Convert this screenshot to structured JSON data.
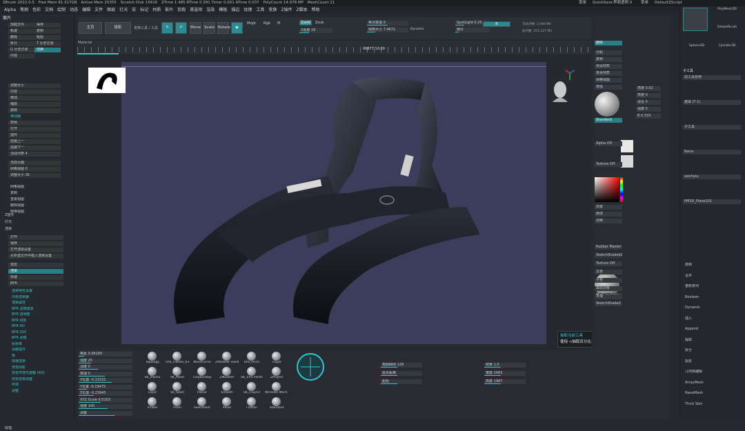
{
  "titlebar": {
    "app": "ZBrush 2022.0.5",
    "items": [
      "Free Mem 81.317GB",
      "Active Mem 25355",
      "Scratch Disk 15616",
      "ZTime 1.485 RTime 0.391 Timer 0.001 ATime 0.037",
      "PolyCount 14.978 MP",
      "MeshCount 21"
    ],
    "right": [
      "菜单",
      "QuickSave",
      "界面透明 0",
      "菜单",
      "DefaultZScript"
    ]
  },
  "menu": [
    "Alpha",
    "笔刷",
    "色彩",
    "文档",
    "绘制",
    "动态",
    "编辑",
    "文件",
    "图层",
    "灯光",
    "宏",
    "标记",
    "材质",
    "影片",
    "拾取",
    "首选项",
    "渲染",
    "模板",
    "描边",
    "纹理",
    "工具",
    "变换",
    "Z插件",
    "Z脚本",
    "帮助"
  ],
  "toolbar": {
    "home": "主页",
    "projection": "投影",
    "tool": "变换工具 / 工具",
    "edit": "Edit",
    "draw": "Draw",
    "move": "Move",
    "scale": "Scale",
    "rotate": "Rotate",
    "mrgb": "Mrgb",
    "rgb": "Rgb",
    "m": "M",
    "zadd": "Zadd",
    "zsub": "Zsub",
    "zcut": "Zcut",
    "focal": "焦点衰减 0",
    "draw_size": "绘制大小 7.4671",
    "dynamic": "Dynamic",
    "z_intensity": "Z强度 25",
    "rgb_intensity": "RGB强度",
    "active_points": "活动点数: 2,048 Mil",
    "total_points": "总点数: 253.127 Mil",
    "subdiv": "细分",
    "subdiv_val": "1",
    "spotlight": "SpotLight 0.25",
    "r_label": "R"
  },
  "timeline": {
    "label": "Material",
    "value": "06877 10:00"
  },
  "left": {
    "header": "案片",
    "rows": [
      {
        "t": "加载文件",
        "cls": ""
      },
      {
        "t": "保存",
        "cls": ""
      },
      {
        "t": "新建",
        "cls": ""
      },
      {
        "t": "复制",
        "cls": ""
      },
      {
        "t": "删除",
        "cls": ""
      },
      {
        "t": "粘贴",
        "cls": ""
      },
      {
        "t": "拆分",
        "cls": ""
      },
      {
        "t": "T 历史记录",
        "cls": ""
      },
      {
        "t": "G 历史记录",
        "cls": ""
      },
      {
        "t": "切换",
        "cls": "teal"
      },
      {
        "t": "内容",
        "cls": ""
      }
    ],
    "section_a": [
      "调整大小",
      "内容",
      "移动",
      "缩放",
      "旋转"
    ],
    "section_b": [
      "移动器",
      "样例",
      "打开",
      "插件",
      "拍摄上一",
      "拍摄下一",
      "活动列表 4"
    ],
    "section_c": [
      "当前页面",
      "网格视图 0",
      "调整大小 36"
    ],
    "section_d": [
      "网格视图",
      "复制",
      "重置视图",
      "删除视图",
      "转换视图"
    ],
    "plugins": [
      "Z插件",
      "灯光",
      "渲染"
    ],
    "render": [
      "打开",
      "保存",
      "打开渲染设置",
      "从所选文件中载入渲染设置"
    ],
    "options": [
      "预览",
      "渲染",
      "快速",
      "BPR"
    ],
    "bpr_list": [
      "渲染特性设置",
      "外部渲染器",
      "渲染属性",
      "BPR 滤镜通道",
      "BPR 透明度",
      "BPR 阴影",
      "BPR AO",
      "BPR SSS",
      "BPR 滤镜",
      "反射率",
      "深度提升",
      "景",
      "快速渲染",
      "预览阴影",
      "预览环境光遮蔽 (AO)",
      "预览效果调整",
      "环境",
      "调整"
    ],
    "footer": "纹理"
  },
  "right": {
    "rows": [
      "删除",
      "分配",
      "复制",
      "预设材质",
      "变更材质",
      "网格视图",
      "增强",
      "Standard",
      "Alpha Off",
      "Texture Off",
      "前景",
      "修改",
      "切换",
      "MatCap Gray",
      "SketchShaded"
    ],
    "sliders": [
      "亮度 0.02",
      "亮度 0",
      "混合 0",
      "强度 0",
      "B 0.333"
    ],
    "labels": [
      "Rubber Master",
      "SketchShaded2",
      "Texture Off",
      "主色",
      "子色",
      "填充对象",
      "平滑"
    ]
  },
  "farright": {
    "tools": [
      "PolyMesh3D",
      "SimpleBrush",
      "Sphere3D",
      "Cylinder3D",
      "PM3D_Plane3D1"
    ],
    "header": "子工具",
    "subtools": [
      "前工具名称",
      "遮罩 (T 1)",
      "子工具",
      "Nana",
      "seichelu",
      "PM3D_Plane101"
    ],
    "list": [
      "复制",
      "合并",
      "重新排列",
      "Boolean",
      "Dynamic",
      "插入",
      "Append",
      "提取",
      "拆分",
      "投影",
      "几何体编辑",
      "ArrayMesh",
      "NanoMesh",
      "Thick Skin"
    ]
  },
  "bottom": {
    "brushes": [
      "Topology",
      "Orb_Flatten_03",
      "MoveCurve",
      "ZModeler Handle",
      "Orb_Pinch",
      "Clayb",
      "SK_Slash2",
      "SK_Move",
      "ClayBuildup",
      "ZModeler",
      "SK_Trim Polish",
      "ZProject",
      "Layer",
      "SK_Slash",
      "Planar",
      "Smooth",
      "SK_ClayFill",
      "Wrinkles Mech A",
      "Inflate",
      "Pinch",
      "SelectRect",
      "Move",
      "Flatten",
      "Standard"
    ],
    "sliders": [
      "焦距 0.06180",
      "强度 25",
      "深度 0",
      "衰减 0",
      "X位置 -0.11531",
      "Y位置 -0.19475",
      "Z位置 -0.23945",
      "XYZ Scale 0.5103",
      "强度 100",
      "调整"
    ],
    "right_sliders": [
      "笔刷曲线 128",
      "延长距离",
      "起始",
      "结束 1.0",
      "宽度 2983",
      "高度 1987"
    ]
  },
  "tooltip": {
    "title": "抽取当前工具",
    "body": "使用 <抽取百分比> 滑块值"
  },
  "colors": {
    "accent": "#2a8b93",
    "cyan": "#35c5cf",
    "viewport": "#3a3e5a"
  }
}
